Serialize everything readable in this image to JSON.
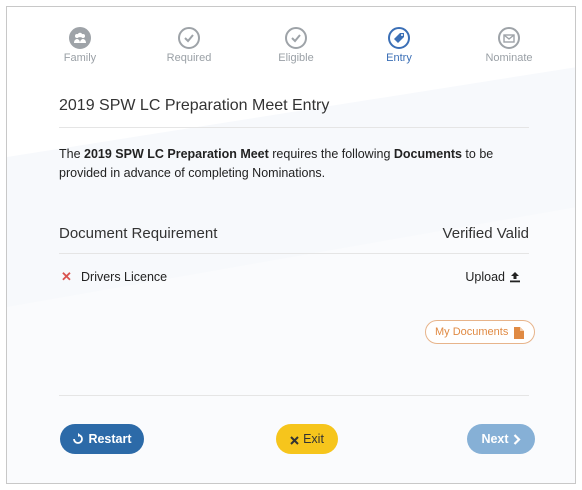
{
  "steps": [
    {
      "label": "Family",
      "icon": "group-icon",
      "state": "done"
    },
    {
      "label": "Required",
      "icon": "check-circle-icon",
      "state": "done"
    },
    {
      "label": "Eligible",
      "icon": "check-circle-icon",
      "state": "done"
    },
    {
      "label": "Entry",
      "icon": "tag-icon",
      "state": "active"
    },
    {
      "label": "Nominate",
      "icon": "envelope-icon",
      "state": "pending"
    }
  ],
  "page": {
    "title": "2019 SPW LC Preparation Meet Entry",
    "intro_pre": "The ",
    "intro_meet": "2019 SPW LC Preparation Meet",
    "intro_mid": " requires the following ",
    "intro_docs": "Documents",
    "intro_post": " to be provided in advance of completing Nominations."
  },
  "table": {
    "col_requirement": "Document Requirement",
    "col_verified": "Verified Valid",
    "rows": [
      {
        "name": "Drivers Licence",
        "status_icon": "x-icon",
        "action": "Upload",
        "action_icon": "upload-icon"
      }
    ]
  },
  "my_documents_label": "My Documents",
  "buttons": {
    "restart": "Restart",
    "exit": "Exit",
    "next": "Next"
  },
  "colors": {
    "accent": "#2c6aa8",
    "active_step": "#3b6fb6",
    "exit": "#f6c51c",
    "next": "#86b0d6",
    "warning": "#e08a43",
    "error": "#d9534f"
  }
}
